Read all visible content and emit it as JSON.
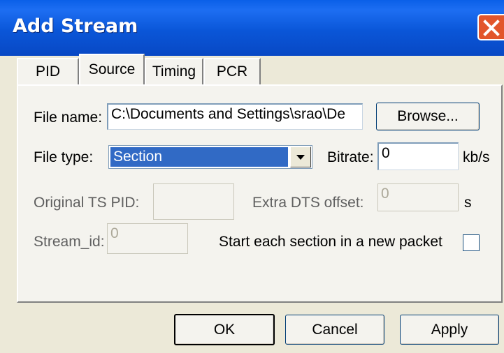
{
  "window": {
    "title": "Add Stream"
  },
  "tabs": [
    {
      "label": "PID"
    },
    {
      "label": "Source"
    },
    {
      "label": "Timing"
    },
    {
      "label": "PCR"
    }
  ],
  "source": {
    "file_name_label": "File name:",
    "file_name_value": "C:\\Documents and Settings\\srao\\De",
    "browse_label": "Browse...",
    "file_type_label": "File type:",
    "file_type_value": "Section",
    "bitrate_label": "Bitrate:",
    "bitrate_value": "0",
    "bitrate_unit": "kb/s",
    "orig_ts_pid_label": "Original TS PID:",
    "orig_ts_pid_value": "",
    "extra_dts_label": "Extra DTS offset:",
    "extra_dts_value": "0",
    "extra_dts_unit": "s",
    "stream_id_label": "Stream_id:",
    "stream_id_value": "0",
    "new_packet_label": "Start each section in a new packet",
    "new_packet_checked": false
  },
  "buttons": {
    "ok": "OK",
    "cancel": "Cancel",
    "apply": "Apply"
  }
}
